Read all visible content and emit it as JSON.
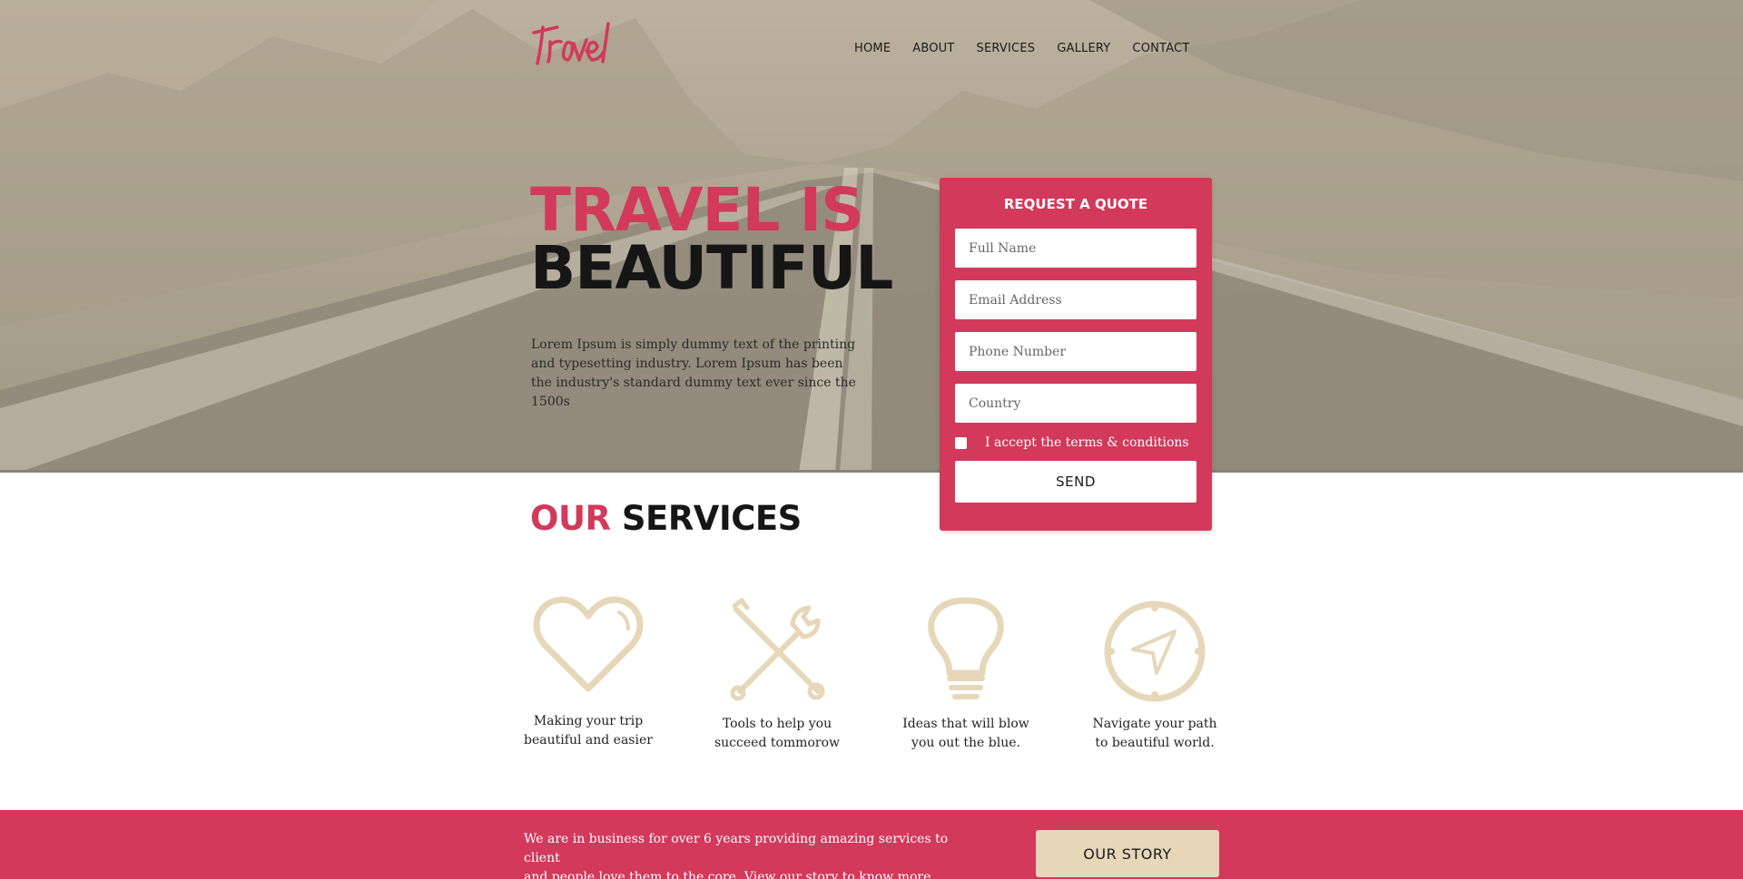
{
  "brand": {
    "logo_text": "travel",
    "accent": "#d2395a",
    "gold": "#e6d7b9"
  },
  "nav": [
    "HOME",
    "ABOUT",
    "SERVICES",
    "GALLERY",
    "CONTACT"
  ],
  "hero": {
    "line1": "TRAVEL IS",
    "line2": "BEAUTIFUL",
    "intro": "Lorem Ipsum is simply dummy text of the printing and typesetting industry. Lorem Ipsum has been the industry's standard dummy text ever since the 1500s"
  },
  "quote": {
    "title": "REQUEST A QUOTE",
    "fields": {
      "name": "Full Name",
      "email": "Email Address",
      "phone": "Phone Number",
      "country": "Country"
    },
    "terms": "I accept the terms & conditions",
    "send": "SEND"
  },
  "services": {
    "title_a": "OUR",
    "title_b": "SERVICES",
    "items": [
      {
        "icon": "heart-icon",
        "line1": "Making your trip",
        "line2": "beautiful and easier"
      },
      {
        "icon": "tools-icon",
        "line1": "Tools to help you",
        "line2": "succeed tommorow"
      },
      {
        "icon": "lightbulb-icon",
        "line1": "Ideas that will blow",
        "line2": "you out the blue."
      },
      {
        "icon": "compass-icon",
        "line1": "Navigate your path",
        "line2": "to beautiful world."
      }
    ]
  },
  "band": {
    "line1": "We are in business for over 6 years providing amazing services to client",
    "line2": "and people love them to the core. View our story to know more.",
    "button": "OUR STORY"
  }
}
